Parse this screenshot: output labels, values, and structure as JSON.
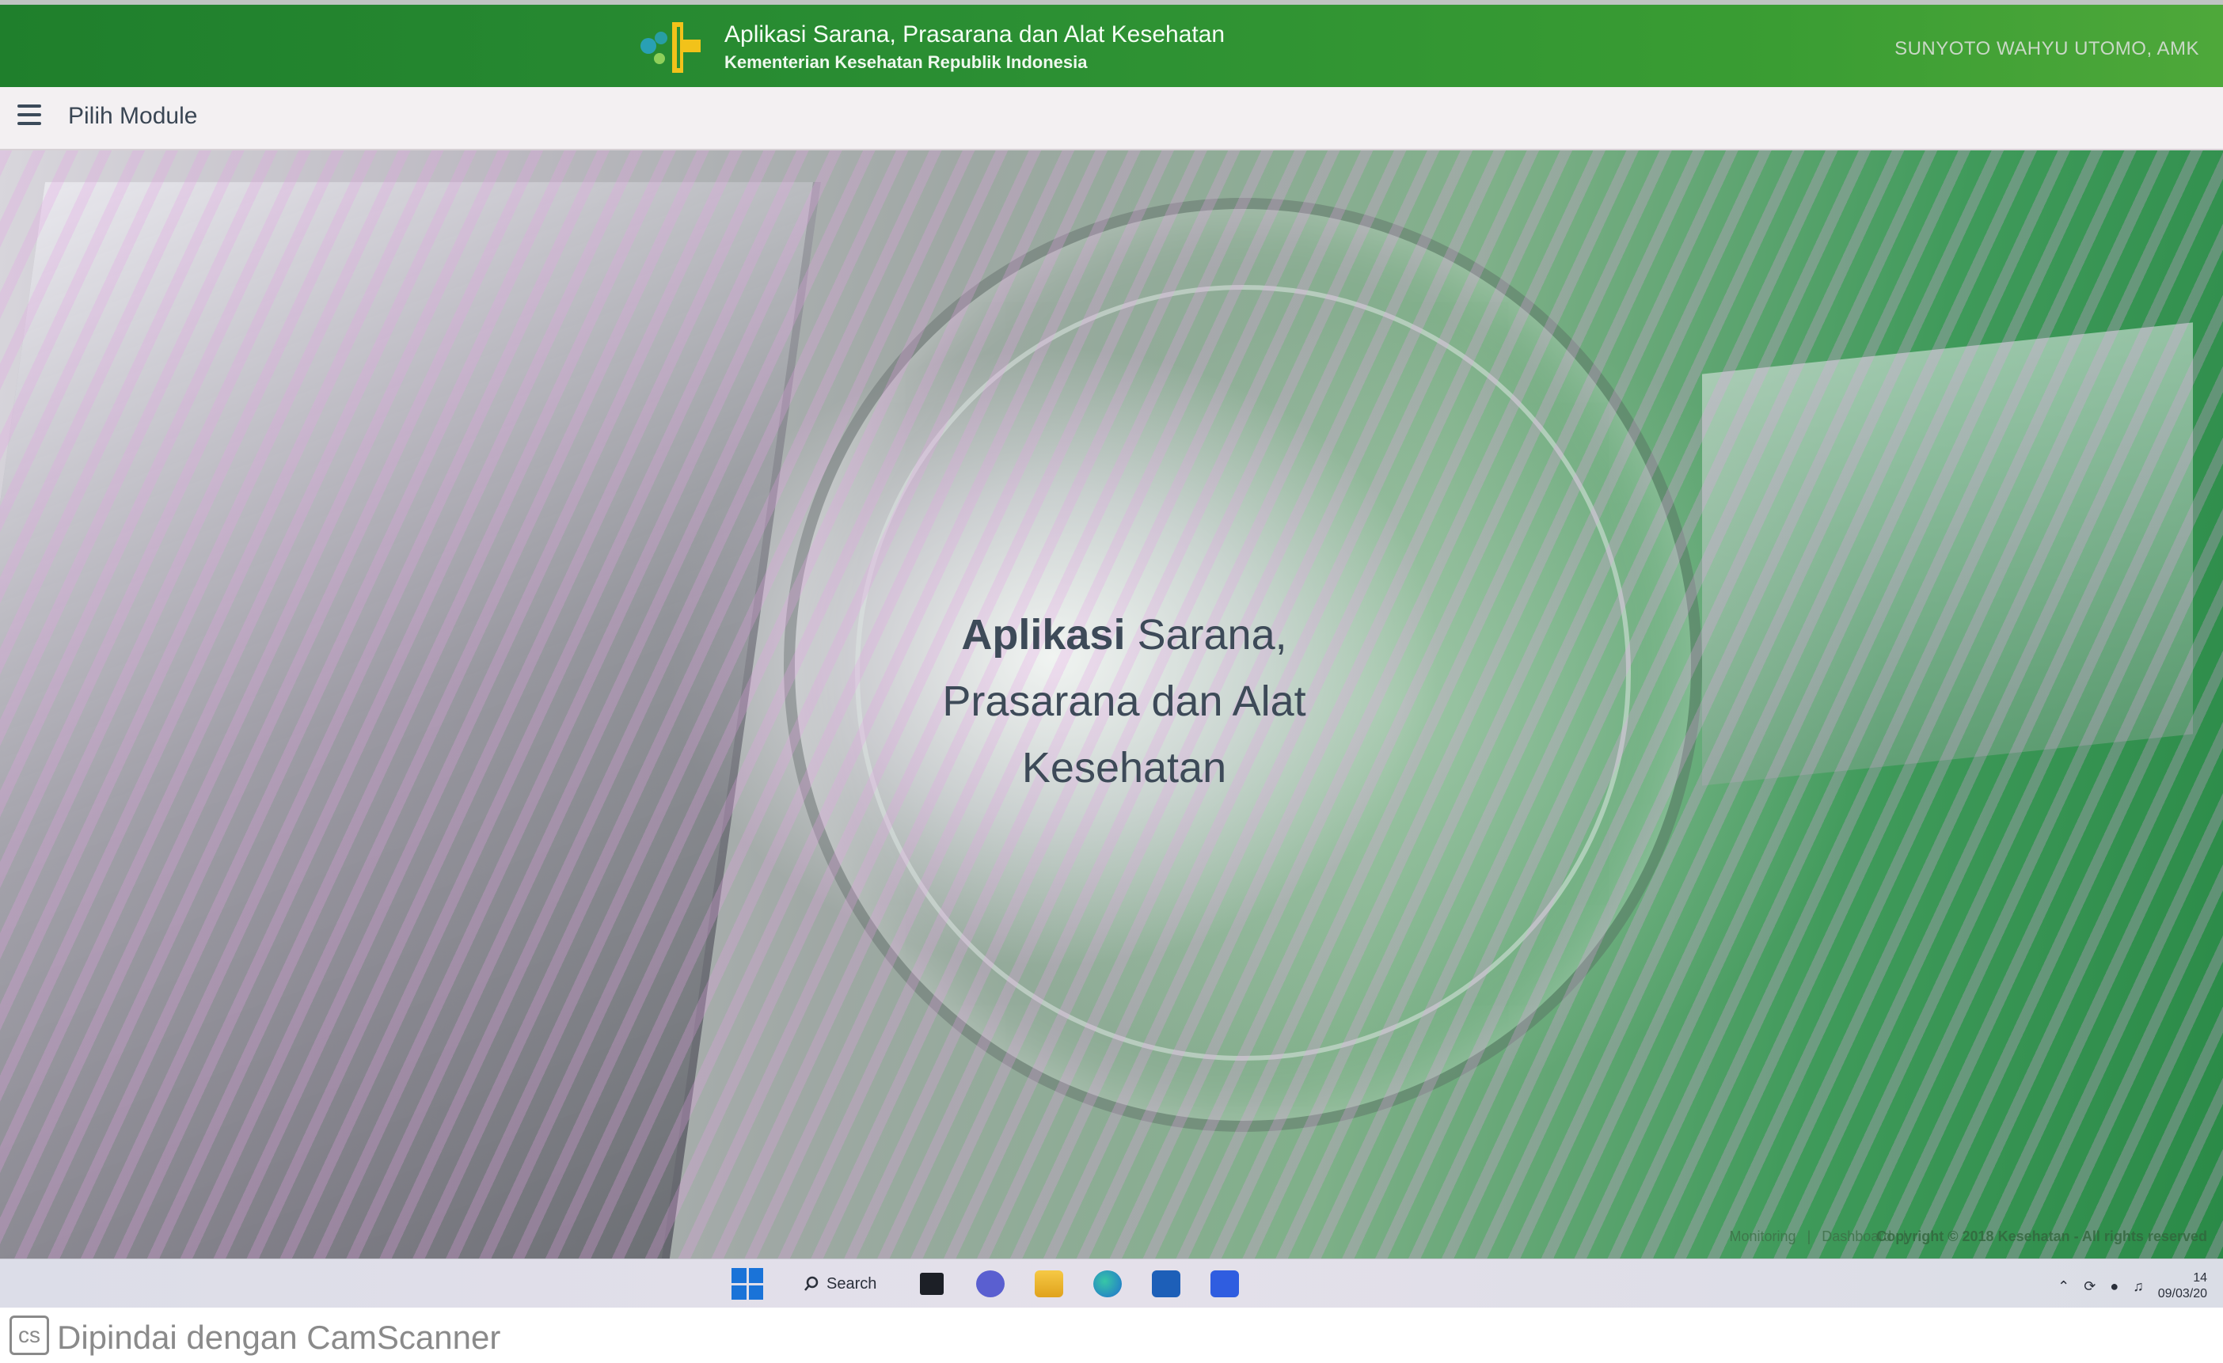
{
  "header": {
    "app_title": "Aplikasi Sarana, Prasarana dan Alat Kesehatan",
    "app_subtitle": "Kementerian Kesehatan Republik Indonesia",
    "user_name": "SUNYOTO WAHYU UTOMO, AMK",
    "brand_colors": {
      "green": "#2b8f33",
      "yellow": "#f2c21a",
      "blue": "#2aa6d6"
    }
  },
  "subheader": {
    "menu_icon": "hamburger-menu-icon",
    "module_label": "Pilih Module"
  },
  "hero": {
    "heading_bold": "Aplikasi",
    "heading_line1_rest": " Sarana,",
    "heading_line2": "Prasarana dan Alat",
    "heading_line3": "Kesehatan"
  },
  "footer": {
    "links": [
      "Monitoring",
      "Dashboard"
    ],
    "separator": "|",
    "copyright": "Copyright © 2018 Kesehatan - All rights reserved"
  },
  "taskbar": {
    "search_label": "Search",
    "icons": [
      "windows-start-icon",
      "search-icon",
      "task-view-icon",
      "meet-icon",
      "file-explorer-icon",
      "edge-icon",
      "store-icon",
      "app-icon"
    ],
    "tray_icons": [
      "chevron-up-icon",
      "sync-icon",
      "wifi-icon",
      "volume-icon"
    ],
    "time": "14",
    "date": "09/03/20"
  },
  "scanner": {
    "badge": "cs",
    "text": "Dipindai dengan CamScanner"
  }
}
